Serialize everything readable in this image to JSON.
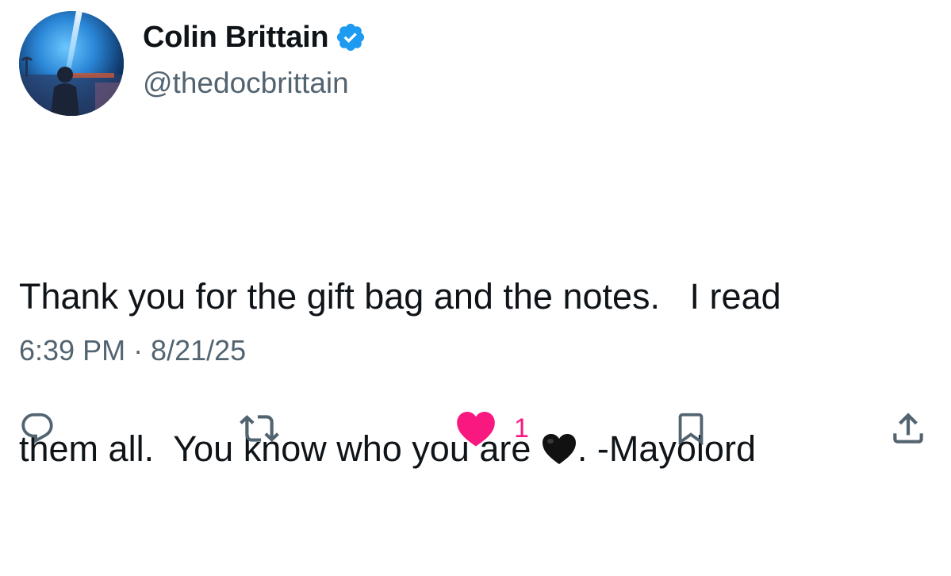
{
  "author": {
    "display_name": "Colin Brittain",
    "handle": "@thedocbrittain",
    "verified": true,
    "verified_color": "#1d9bf0"
  },
  "tweet": {
    "text_line_1": "Thank you for the gift bag and the notes.   I read",
    "text_line_2_before_emoji": "them all.  You know who you are ",
    "text_line_2_after_emoji": ". -Mayolord",
    "emoji": "black-heart",
    "timestamp": "6:39 PM · 8/21/25"
  },
  "actions": {
    "reply_icon": "reply-icon",
    "retweet_icon": "retweet-icon",
    "like_icon": "heart-icon",
    "like_count": "1",
    "like_color": "#f91880",
    "bookmark_icon": "bookmark-icon",
    "share_icon": "share-icon",
    "icon_color": "#536471"
  }
}
